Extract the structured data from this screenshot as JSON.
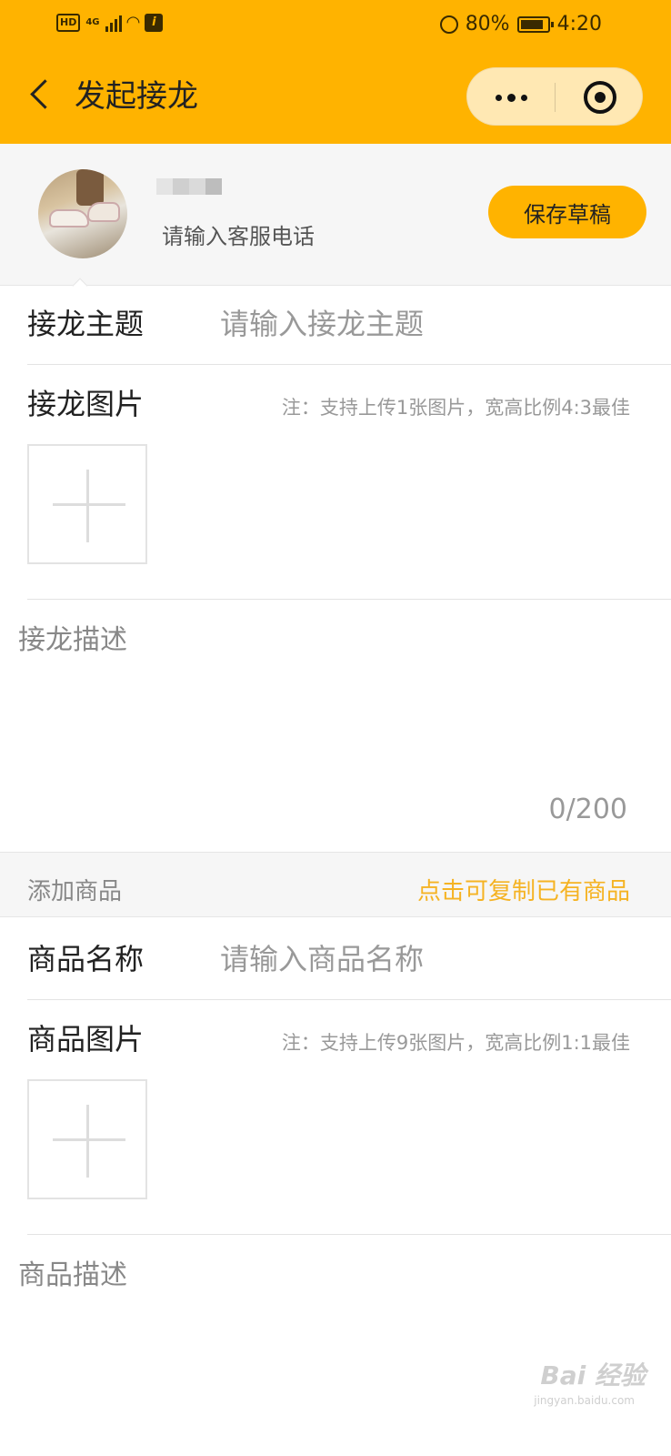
{
  "status_bar": {
    "hd": "HD",
    "network": "4G",
    "info_glyph": "i",
    "battery_percent": "80%",
    "time": "4:20"
  },
  "nav": {
    "title": "发起接龙",
    "back_icon": "chevron-left-icon",
    "menu_icon": "more-dots-icon",
    "close_icon": "target-icon"
  },
  "profile": {
    "phone_placeholder": "请输入客服电话",
    "save_draft_label": "保存草稿"
  },
  "topic": {
    "label": "接龙主题",
    "placeholder": "请输入接龙主题"
  },
  "topic_image": {
    "label": "接龙图片",
    "note": "注：支持上传1张图片，宽高比例4:3最佳"
  },
  "topic_desc": {
    "placeholder": "接龙描述",
    "counter": "0/200"
  },
  "product_section": {
    "title": "添加商品",
    "copy_link": "点击可复制已有商品"
  },
  "product_name": {
    "label": "商品名称",
    "placeholder": "请输入商品名称"
  },
  "product_image": {
    "label": "商品图片",
    "note": "注：支持上传9张图片，宽高比例1:1最佳"
  },
  "product_desc": {
    "placeholder": "商品描述"
  },
  "watermark": {
    "brand": "Bai 经验",
    "url": "jingyan.baidu.com"
  },
  "colors": {
    "accent": "#FFB300",
    "link": "#F5B323",
    "background": "#F6F6F6"
  }
}
